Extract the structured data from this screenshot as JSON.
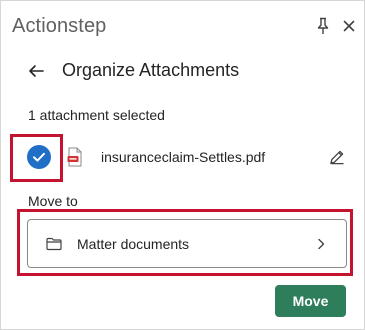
{
  "window": {
    "app_title": "Actionstep"
  },
  "header": {
    "title": "Organize Attachments"
  },
  "selection": {
    "count_text": "1 attachment selected"
  },
  "attachments": [
    {
      "file_name": "insuranceclaim-Settles.pdf",
      "selected": true
    }
  ],
  "move": {
    "label": "Move to",
    "destination": "Matter documents",
    "button_label": "Move"
  },
  "colors": {
    "accent_blue": "#1f6fc6",
    "primary_green": "#2e7d5b",
    "highlight_red": "#c4122f",
    "pdf_red": "#d13438"
  },
  "icons": {
    "pin": "pin-icon",
    "close": "close-icon",
    "back": "back-arrow-icon",
    "check": "checkmark-icon",
    "pdf": "pdf-file-icon",
    "edit": "pencil-icon",
    "folder": "folder-icon",
    "chevron": "chevron-right-icon"
  }
}
